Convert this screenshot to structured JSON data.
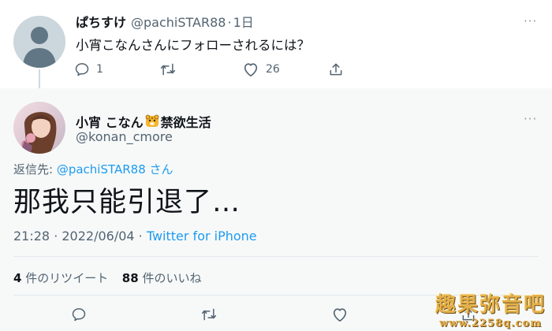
{
  "original_tweet": {
    "display_name": "ぱちすけ",
    "handle": "@pachiSTAR88",
    "separator": "·",
    "time": "1日",
    "text": "小宵こなんさんにフォローされるには？",
    "reply_count": "1",
    "retweet_count": "",
    "like_count": "26",
    "more_icon": "more-dots-icon"
  },
  "reply_tweet": {
    "display_name": "小宵 こなん",
    "display_name_suffix": "禁欲生活",
    "handle": "@konan_cmore",
    "reply_to_label": "返信先: ",
    "reply_to_handle": "@pachiSTAR88",
    "reply_to_suffix": " さん",
    "text": "那我只能引退了…",
    "timestamp": "21:28 · 2022/06/04 · ",
    "source": "Twitter for iPhone",
    "retweet_count": "4",
    "retweet_label": "件のリツイート",
    "like_count": "88",
    "like_label": "件のいいね"
  },
  "watermark": {
    "title": "趣果弥音吧",
    "url": "www.2258q.com"
  },
  "colors": {
    "link": "#1d9bf0",
    "muted": "#536471",
    "text": "#0f1419",
    "reply_background": "#f7f9f9",
    "watermark_gold": "#e5b14a"
  }
}
